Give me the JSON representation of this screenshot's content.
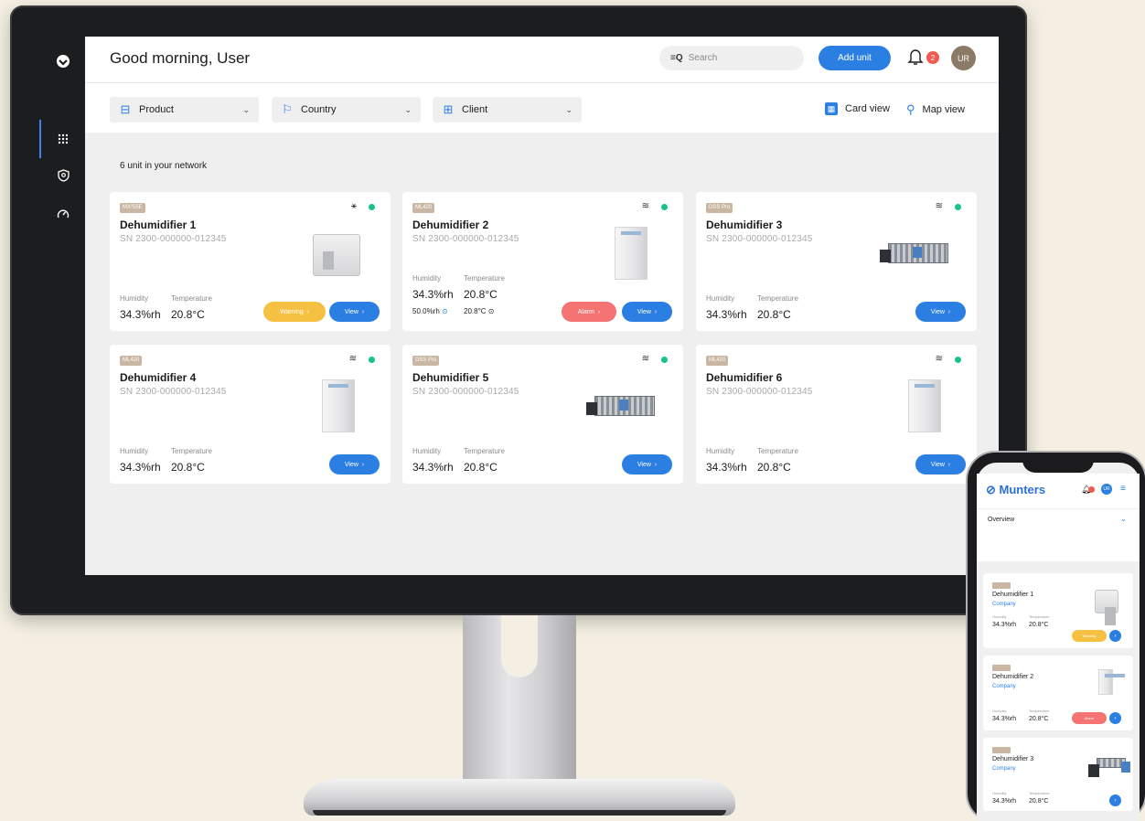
{
  "header": {
    "greeting": "Good morning, User",
    "search_placeholder": "Search",
    "add_unit_label": "Add unit",
    "notification_count": "2",
    "avatar_initials": "UR"
  },
  "filters": {
    "product": "Product",
    "country": "Country",
    "client": "Client",
    "card_view": "Card view",
    "map_view": "Map view"
  },
  "network_count_text": "6 unit in your network",
  "labels": {
    "humidity": "Humidity",
    "temperature": "Temperature",
    "view": "View",
    "warning": "Warning",
    "alarm": "Alarm"
  },
  "cards": [
    {
      "tag": "MX²55E",
      "title": "Dehumidifier 1",
      "sn": "SN 2300-000000-012345",
      "humidity": "34.3%rh",
      "temperature": "20.8°C",
      "status": "warning",
      "connected": false
    },
    {
      "tag": "ML420",
      "title": "Dehumidifier 2",
      "sn": "SN 2300-000000-012345",
      "humidity": "34.3%rh",
      "temperature": "20.8°C",
      "setpoint_humidity": "50.0%rh",
      "setpoint_temperature": "20.8°C",
      "status": "alarm",
      "connected": true
    },
    {
      "tag": "DSS Pro",
      "title": "Dehumidifier 3",
      "sn": "SN 2300-000000-012345",
      "humidity": "34.3%rh",
      "temperature": "20.8°C",
      "status": "ok",
      "connected": true
    },
    {
      "tag": "ML420",
      "title": "Dehumidifier 4",
      "sn": "SN 2300-000000-012345",
      "humidity": "34.3%rh",
      "temperature": "20.8°C",
      "status": "ok",
      "connected": true
    },
    {
      "tag": "DSS Pro",
      "title": "Dehumidifier 5",
      "sn": "SN 2300-000000-012345",
      "humidity": "34.3%rh",
      "temperature": "20.8°C",
      "status": "ok",
      "connected": true
    },
    {
      "tag": "ML420",
      "title": "Dehumidifier 6",
      "sn": "SN 2300-000000-012345",
      "humidity": "34.3%rh",
      "temperature": "20.8°C",
      "status": "ok",
      "connected": true
    }
  ],
  "phone": {
    "brand": "Munters",
    "overview_label": "Overview",
    "company": "Company",
    "cards": [
      {
        "title": "Dehumidifier 1",
        "humidity": "34.3%rh",
        "temperature": "20.8°C",
        "status": "warning"
      },
      {
        "title": "Dehumidifier 2",
        "humidity": "34.3%rh",
        "temperature": "20.8°C",
        "status": "alarm"
      },
      {
        "title": "Dehumidifier 3",
        "humidity": "34.3%rh",
        "temperature": "20.8°C",
        "status": "ok"
      }
    ]
  },
  "colors": {
    "accent": "#2b7fe3",
    "warning": "#f6c142",
    "alarm": "#f57373",
    "online": "#17c28c",
    "tag": "#c9b7a3"
  }
}
